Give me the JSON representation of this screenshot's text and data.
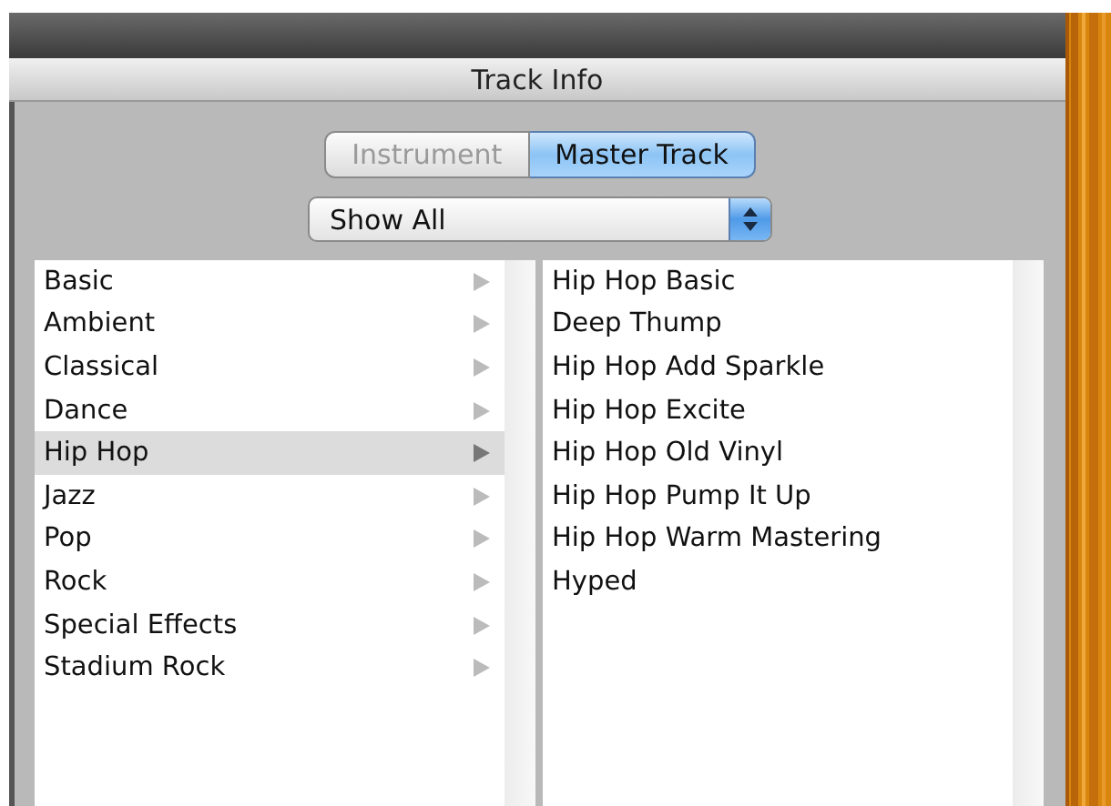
{
  "window": {
    "title": "Track Info"
  },
  "segments": [
    {
      "label": "Instrument",
      "selected": false
    },
    {
      "label": "Master Track",
      "selected": true
    }
  ],
  "popup": {
    "value": "Show All"
  },
  "categories": [
    {
      "label": "Basic",
      "selected": false
    },
    {
      "label": "Ambient",
      "selected": false
    },
    {
      "label": "Classical",
      "selected": false
    },
    {
      "label": "Dance",
      "selected": false
    },
    {
      "label": "Hip Hop",
      "selected": true
    },
    {
      "label": "Jazz",
      "selected": false
    },
    {
      "label": "Pop",
      "selected": false
    },
    {
      "label": "Rock",
      "selected": false
    },
    {
      "label": "Special Effects",
      "selected": false
    },
    {
      "label": "Stadium Rock",
      "selected": false
    }
  ],
  "presets": [
    {
      "label": "Hip Hop Basic"
    },
    {
      "label": "Deep Thump"
    },
    {
      "label": "Hip Hop Add Sparkle"
    },
    {
      "label": "Hip Hop Excite"
    },
    {
      "label": "Hip Hop Old Vinyl"
    },
    {
      "label": "Hip Hop Pump It Up"
    },
    {
      "label": "Hip Hop Warm Mastering"
    },
    {
      "label": "Hyped"
    }
  ]
}
